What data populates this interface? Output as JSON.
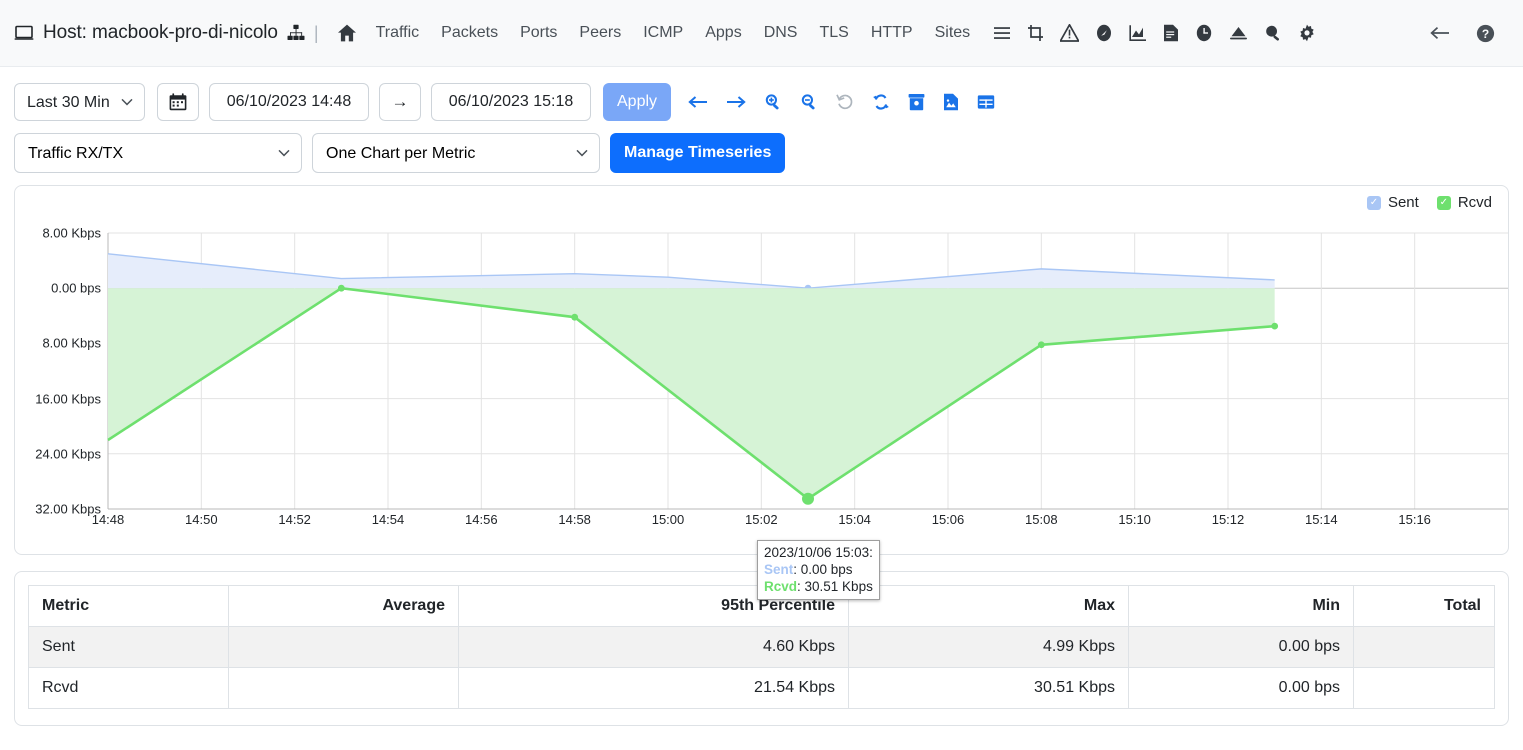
{
  "navbar": {
    "host_label": "Host: macbook-pro-di-nicolo",
    "separator": "|",
    "links": [
      "Traffic",
      "Packets",
      "Ports",
      "Peers",
      "ICMP",
      "Apps",
      "DNS",
      "TLS",
      "HTTP",
      "Sites"
    ],
    "icons": [
      "hamburger-icon",
      "crop-icon",
      "alert-triangle-icon",
      "compass-icon",
      "chart-icon",
      "report-icon",
      "clock-icon",
      "upload-icon",
      "search-icon",
      "gear-icon"
    ],
    "right_icons": [
      "back-arrow-icon",
      "help-icon"
    ]
  },
  "toolbar": {
    "range_preset": "Last 30 Min",
    "date_from": "06/10/2023 14:48",
    "date_to": "06/10/2023 15:18",
    "range_arrow": "→",
    "apply_label": "Apply",
    "icons": [
      "step-back-icon",
      "step-forward-icon",
      "zoom-in-icon",
      "zoom-out-icon",
      "undo-icon",
      "refresh-icon",
      "archive-icon",
      "image-export-icon",
      "table-export-icon"
    ],
    "metric_select": "Traffic RX/TX",
    "layout_select": "One Chart per Metric",
    "manage_label": "Manage Timeseries"
  },
  "chart_data": {
    "type": "area",
    "title": "",
    "xlabel": "",
    "ylabel": "",
    "grid": true,
    "legend_position": "top-right",
    "legend": [
      {
        "name": "Sent",
        "color": "#a9c6f5",
        "fill": "#e6edfb",
        "checked": true
      },
      {
        "name": "Rcvd",
        "color": "#6ee06e",
        "fill": "#d6f3d6",
        "checked": true
      }
    ],
    "y_ticks": [
      "8.00 Kbps",
      "0.00 bps",
      "8.00 Kbps",
      "16.00 Kbps",
      "24.00 Kbps",
      "32.00 Kbps"
    ],
    "y_tick_values": [
      8000,
      0,
      -8000,
      -16000,
      -24000,
      -32000
    ],
    "y_axis_note": "Sent plotted upward, Rcvd plotted downward (mirrored axis)",
    "ylim": [
      -32000,
      8000
    ],
    "x_ticks": [
      "14:48",
      "14:50",
      "14:52",
      "14:54",
      "14:56",
      "14:58",
      "15:00",
      "15:02",
      "15:04",
      "15:06",
      "15:08",
      "15:10",
      "15:12",
      "15:14",
      "15:16"
    ],
    "xlim": [
      "14:48",
      "15:18"
    ],
    "series": [
      {
        "name": "Sent",
        "x": [
          "14:48",
          "14:53",
          "14:58",
          "15:00",
          "15:03",
          "15:08",
          "15:13"
        ],
        "values": [
          4990,
          1400,
          2100,
          1600,
          0,
          2800,
          1200
        ],
        "unit": "bps"
      },
      {
        "name": "Rcvd",
        "x": [
          "14:48",
          "14:53",
          "14:58",
          "15:03",
          "15:08",
          "15:13"
        ],
        "values": [
          -22000,
          0,
          -4200,
          -30510,
          -8200,
          -5500
        ],
        "unit": "bps"
      }
    ],
    "highlight_point": {
      "x": "15:03",
      "sent": "0.00 bps",
      "rcvd": "30.51 Kbps"
    }
  },
  "tooltip": {
    "timestamp": "2023/10/06 15:03:",
    "rows": [
      {
        "label": "Sent",
        "value": ": 0.00 bps"
      },
      {
        "label": "Rcvd",
        "value": ": 30.51 Kbps"
      }
    ]
  },
  "stats_table": {
    "columns": [
      "Metric",
      "Average",
      "95th Percentile",
      "Max",
      "Min",
      "Total"
    ],
    "rows": [
      {
        "metric": "Sent",
        "average": "",
        "p95": "4.60 Kbps",
        "max": "4.99 Kbps",
        "min": "0.00 bps",
        "total": ""
      },
      {
        "metric": "Rcvd",
        "average": "",
        "p95": "21.54 Kbps",
        "max": "30.51 Kbps",
        "min": "0.00 bps",
        "total": ""
      }
    ]
  }
}
